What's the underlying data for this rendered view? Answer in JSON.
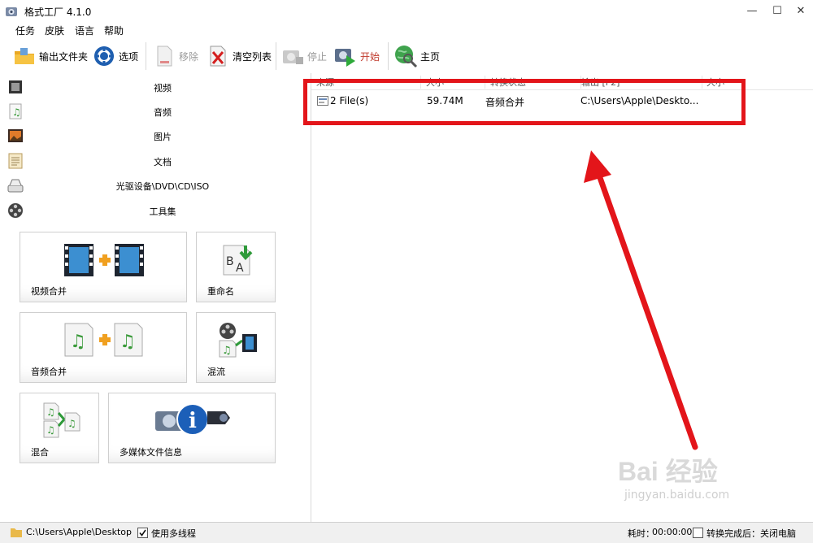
{
  "window": {
    "title": "格式工厂 4.1.0",
    "controls": [
      "—",
      "☐",
      "✕"
    ]
  },
  "menu": [
    "任务",
    "皮肤",
    "语言",
    "帮助"
  ],
  "toolbar": {
    "output_folder": "输出文件夹",
    "options": "选项",
    "remove": "移除",
    "clear_list": "清空列表",
    "stop": "停止",
    "start": "开始",
    "home": "主页"
  },
  "categories": [
    "视频",
    "音频",
    "图片",
    "文档",
    "光驱设备\\DVD\\CD\\ISO",
    "工具集"
  ],
  "tools": {
    "video_merge": "视频合并",
    "rename": "重命名",
    "audio_merge": "音频合并",
    "remux": "混流",
    "mix": "混合",
    "media_info": "多媒体文件信息"
  },
  "tasklist": {
    "columns": [
      "来源",
      "大小",
      "转换状态",
      "输出 [F2]",
      "大小"
    ],
    "rows": [
      {
        "source": "2 File(s)",
        "size": "59.74M",
        "status": "音频合并",
        "output": "C:\\Users\\Apple\\Deskto..."
      }
    ]
  },
  "status": {
    "output_path": "C:\\Users\\Apple\\Desktop",
    "multithread_label": "使用多线程",
    "multithread_checked": true,
    "elapsed_label": "耗时：",
    "elapsed_value": "00:00:00",
    "after_convert_label": "转换完成后：关闭电脑",
    "after_convert_checked": false
  },
  "watermark": {
    "logo": "Bai 经验",
    "url": "jingyan.baidu.com"
  },
  "colors": {
    "annotation": "#e3151a",
    "start_text": "#c0392b"
  }
}
